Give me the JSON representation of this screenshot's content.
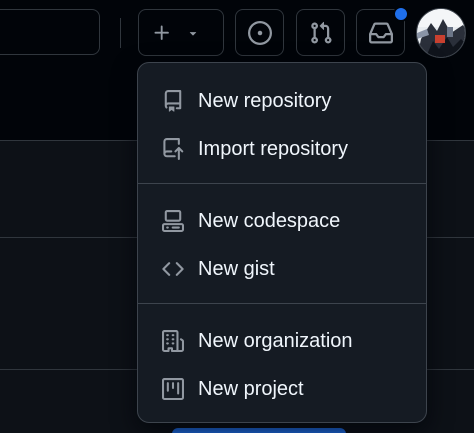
{
  "header": {
    "create_button_icon": "plus-icon",
    "create_caret_icon": "triangle-down-icon",
    "issues_icon": "issue-opened-icon",
    "pulls_icon": "git-pull-request-icon",
    "inbox_icon": "inbox-icon",
    "notification_dot_color": "#1f6feb",
    "avatar_icon": "user-avatar"
  },
  "menu": {
    "groups": [
      {
        "items": [
          {
            "label": "New repository",
            "icon": "repo-icon"
          },
          {
            "label": "Import repository",
            "icon": "repo-push-icon"
          }
        ]
      },
      {
        "items": [
          {
            "label": "New codespace",
            "icon": "codespaces-icon"
          },
          {
            "label": "New gist",
            "icon": "code-icon"
          }
        ]
      },
      {
        "items": [
          {
            "label": "New organization",
            "icon": "organization-icon"
          },
          {
            "label": "New project",
            "icon": "table-icon"
          }
        ]
      }
    ]
  },
  "colors": {
    "background": "#010409",
    "menu_background": "#151b23",
    "border": "#3d444d",
    "text": "#f0f6fc",
    "icon": "#9198a1",
    "accent": "#1f6feb"
  }
}
